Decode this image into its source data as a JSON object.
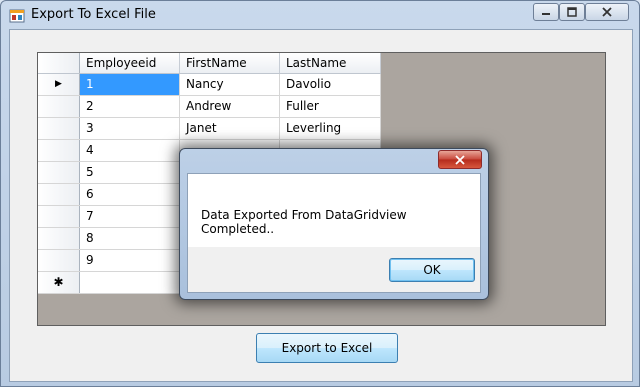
{
  "window": {
    "title": "Export To Excel File"
  },
  "grid": {
    "columns": [
      "Employeeid",
      "FirstName",
      "LastName"
    ],
    "rows": [
      [
        "1",
        "Nancy",
        "Davolio"
      ],
      [
        "2",
        "Andrew",
        "Fuller"
      ],
      [
        "3",
        "Janet",
        "Leverling"
      ],
      [
        "4",
        "",
        ""
      ],
      [
        "5",
        "",
        ""
      ],
      [
        "6",
        "",
        ""
      ],
      [
        "7",
        "",
        ""
      ],
      [
        "8",
        "",
        ""
      ],
      [
        "9",
        "",
        ""
      ]
    ],
    "current_row_marker": "▶",
    "new_row_marker": "✱"
  },
  "export_button": {
    "label": "Export to Excel"
  },
  "dialog": {
    "message": "Data Exported From DataGridview Completed..",
    "ok_label": "OK"
  },
  "colors": {
    "selection": "#3399ff",
    "grid_background": "#aba59f"
  }
}
